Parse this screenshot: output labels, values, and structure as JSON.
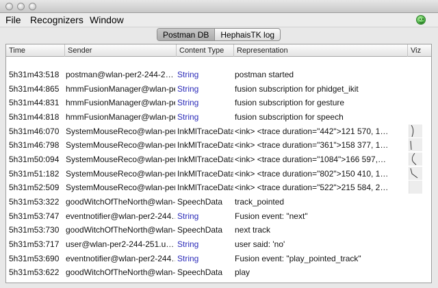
{
  "menu": {
    "file": "File",
    "recognizers": "Recognizers",
    "window": "Window"
  },
  "tabs": [
    {
      "label": "Postman DB",
      "active": true
    },
    {
      "label": "HephaisTK log",
      "active": false
    }
  ],
  "table": {
    "columns": {
      "time": "Time",
      "sender": "Sender",
      "type": "Content Type",
      "repr": "Representation",
      "viz": "Viz"
    },
    "rows": [
      {
        "time": "5h31m43:518",
        "sender": "postman@wlan-per2-244-2…",
        "type": "String",
        "repr": "postman started"
      },
      {
        "time": "5h31m44:865",
        "sender": "hmmFusionManager@wlan-pe…",
        "type": "String",
        "repr": "fusion subscription for phidget_ikit"
      },
      {
        "time": "5h31m44:831",
        "sender": "hmmFusionManager@wlan-pe…",
        "type": "String",
        "repr": "fusion subscription for gesture"
      },
      {
        "time": "5h31m44:818",
        "sender": "hmmFusionManager@wlan-pe…",
        "type": "String",
        "repr": "fusion subscription for speech"
      },
      {
        "time": "5h31m46:070",
        "sender": "SystemMouseReco@wlan-per…",
        "type": "InkMlTraceData",
        "repr": "<ink>     <trace duration=\"442\">121 570, 1…"
      },
      {
        "time": "5h31m46:798",
        "sender": "SystemMouseReco@wlan-per…",
        "type": "InkMlTraceData",
        "repr": "<ink>     <trace duration=\"361\">158 377, 1…"
      },
      {
        "time": "5h31m50:094",
        "sender": "SystemMouseReco@wlan-per…",
        "type": "InkMlTraceData",
        "repr": "<ink>     <trace duration=\"1084\">166 597,…"
      },
      {
        "time": "5h31m51:182",
        "sender": "SystemMouseReco@wlan-per…",
        "type": "InkMlTraceData",
        "repr": "<ink>     <trace duration=\"802\">150 410, 1…"
      },
      {
        "time": "5h31m52:509",
        "sender": "SystemMouseReco@wlan-per…",
        "type": "InkMlTraceData",
        "repr": "<ink>     <trace duration=\"522\">215 584, 2…"
      },
      {
        "time": "5h31m53:322",
        "sender": "goodWitchOfTheNorth@wlan-…",
        "type": "SpeechData",
        "repr": "track_pointed"
      },
      {
        "time": "5h31m53:747",
        "sender": "eventnotifier@wlan-per2-244…",
        "type": "String",
        "repr": "Fusion event: \"next\""
      },
      {
        "time": "5h31m53:730",
        "sender": "goodWitchOfTheNorth@wlan-…",
        "type": "SpeechData",
        "repr": "next track"
      },
      {
        "time": "5h31m53:717",
        "sender": "user@wlan-per2-244-251.u…",
        "type": "String",
        "repr": "user said: 'no'"
      },
      {
        "time": "5h31m53:690",
        "sender": "eventnotifier@wlan-per2-244…",
        "type": "String",
        "repr": "Fusion event: \"play_pointed_track\""
      },
      {
        "time": "5h31m53:622",
        "sender": "goodWitchOfTheNorth@wlan-…",
        "type": "SpeechData",
        "repr": "play"
      }
    ]
  },
  "icons": {
    "status": "smiley-status-icon",
    "viz": "ink-trace-thumbnail-icon"
  },
  "colors": {
    "string_type": "#2a2ab8",
    "status_green": "#3fa93a"
  }
}
